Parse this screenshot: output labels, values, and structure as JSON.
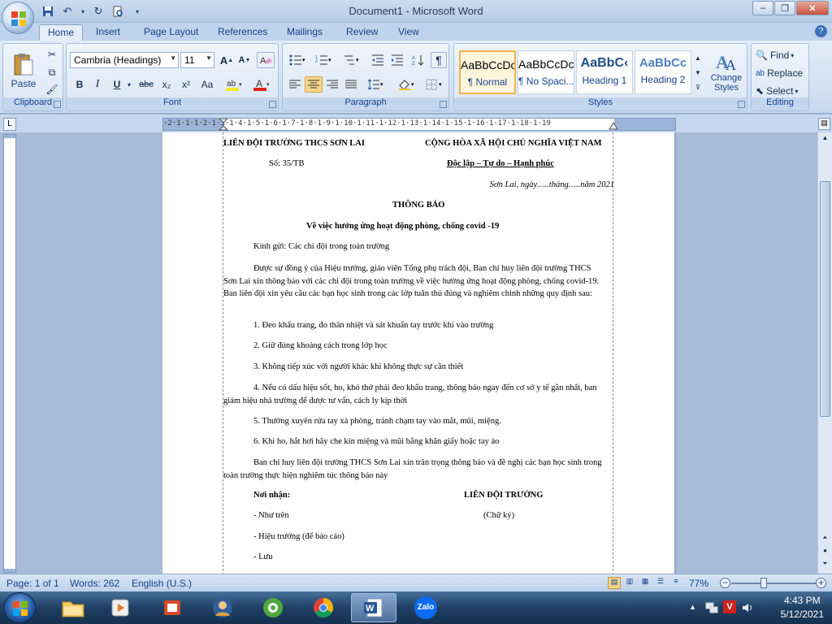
{
  "window": {
    "title": "Document1 - Microsoft Word",
    "minimize": "–",
    "maximize": "❐",
    "close": "✕"
  },
  "ribbon_tabs": [
    "Home",
    "Insert",
    "Page Layout",
    "References",
    "Mailings",
    "Review",
    "View"
  ],
  "clipboard": {
    "paste": "Paste",
    "label": "Clipboard"
  },
  "font": {
    "name": "Cambria (Headings)",
    "size": "11",
    "label": "Font",
    "bold": "B",
    "italic": "I",
    "underline": "U",
    "strike": "abc",
    "subscript": "x₂",
    "superscript": "x²",
    "case": "Aa",
    "grow": "A",
    "shrink": "A"
  },
  "paragraph": {
    "label": "Paragraph",
    "pilcrow": "¶"
  },
  "styles": {
    "label": "Styles",
    "items": [
      {
        "preview": "AaBbCcDc",
        "name": "¶ Normal"
      },
      {
        "preview": "AaBbCcDc",
        "name": "¶ No Spaci..."
      },
      {
        "preview": "AaBbC‹",
        "name": "Heading 1"
      },
      {
        "preview": "AaBbCc",
        "name": "Heading 2"
      }
    ],
    "change_styles": "Change Styles"
  },
  "editing": {
    "label": "Editing",
    "find": "Find",
    "replace": "Replace",
    "select": "Select"
  },
  "ruler": {
    "ticks": "·2·1·1·1·2·1·3·1·4·1·5·1·6·1·7·1·8·1·9·1·10·1·11·1·12·1·13·1·14·1·15·1·16·1·17·1·18·1·19"
  },
  "document": {
    "org_left": "LIÊN ĐỘI TRƯỜNG THCS  SƠN LAI",
    "org_right": "CỘNG HÒA XÃ HỘI CHỦ NGHĨA VIỆT NAM",
    "number": "Số: 35/TB",
    "motto": "Độc lập – Tự do – Hạnh phúc",
    "date": "Sơn Lai, ngày…..tháng…..năm 2021",
    "title": "THÔNG BÁO",
    "subtitle": "Về việc hưởng ứng hoạt động phòng, chống covid  -19",
    "greeting": "Kính gửi:  Các chi đội trong toàn trường",
    "intro": "Được sự đồng ý của Hiệu trưởng, giáo viên Tổng phụ trách đội, Ban chỉ huy liên đội trường THCS Sơn Lai xin thông báo với các chi đội trong toàn trường về việc hưởng ứng hoạt động phòng, chống covid-19. Ban liên đội xin yêu  cầu các bạn học sinh trong các lớp tuân thủ đúng và nghiêm chỉnh những quy định sau:",
    "rules": [
      "1. Đeo khẩu trang, đo thân nhiệt và sát khuẩn tay trước khi vào trường",
      "2. Giữ đúng khoảng cách trong lớp học",
      "3. Không tiếp xúc với người khác khi không thực sự cần thiết",
      "4. Nếu có dấu hiệu sốt, ho, khó thở phải đeo khẩu trang, thông báo ngay đến cơ sở y tế gần nhất, ban giám hiệu nhà trường để được tư vấn, cách ly kịp thời",
      "5. Thường xuyên rửa tay xà phòng, tránh chạm tay vào mắt, mũi, miệng.",
      "6.  Khi ho, hắt hơi hãy che kín miệng và mũi bằng khăn giấy  hoặc tay áo"
    ],
    "closing": "Ban chỉ huy liên đội trường THCS Sơn Lai xin trân trọng thông báo và đề nghị các bạn học sinh trong toàn trường thực hiện nghiêm  túc thông báo này",
    "recipients_label": "Nơi nhận:",
    "signer_title": "LIÊN ĐỘI TRƯỞNG",
    "recipients": [
      "- Như trên",
      "- Hiệu trưởng (để báo cáo)",
      "- Lưu"
    ],
    "signature": "(Chữ ký)"
  },
  "status": {
    "page": "Page: 1 of 1",
    "words": "Words: 262",
    "language": "English (U.S.)",
    "zoom": "77%",
    "zoom_level": 77
  },
  "taskbar": {
    "time": "4:43 PM",
    "date": "5/12/2021",
    "zalo": "Zalo"
  },
  "colors": {
    "accent": "#15428b",
    "ribbon": "#dbe6f4",
    "workspace": "#a9bcd7"
  }
}
